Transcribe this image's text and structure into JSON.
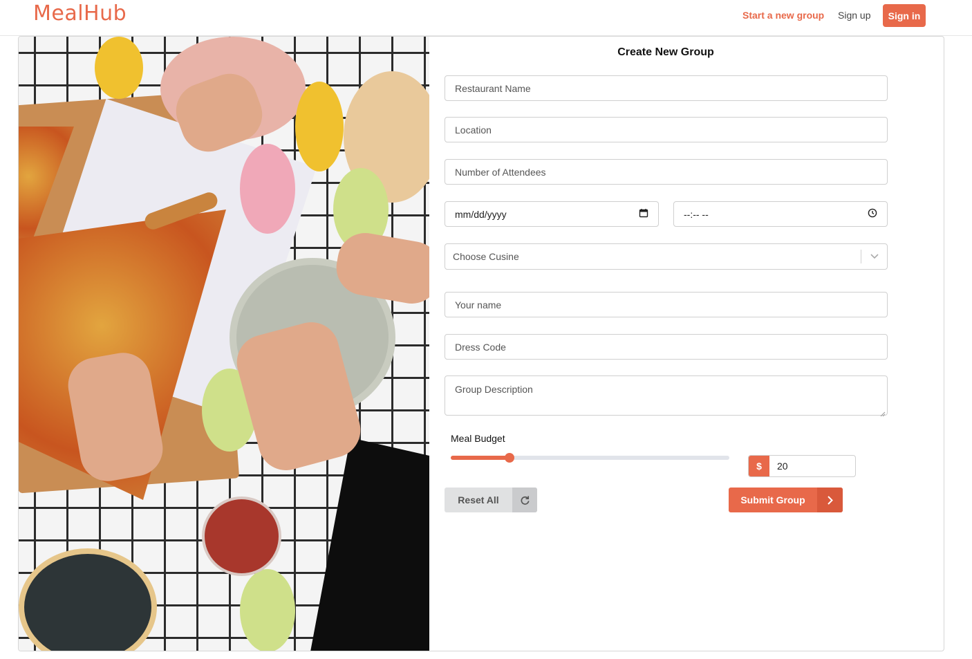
{
  "header": {
    "logo": "MealHub",
    "nav": {
      "start_group": "Start a new group",
      "sign_up": "Sign up",
      "sign_in": "Sign in"
    }
  },
  "form": {
    "title": "Create New Group",
    "fields": {
      "restaurant_name": {
        "placeholder": "Restaurant Name"
      },
      "location": {
        "placeholder": "Location"
      },
      "attendees": {
        "placeholder": "Number of Attendees"
      },
      "date": {
        "placeholder": "mm/dd/yyyy"
      },
      "time": {
        "placeholder": "--:-- --"
      },
      "cuisine": {
        "placeholder": "Choose Cusine"
      },
      "your_name": {
        "placeholder": "Your name"
      },
      "dress_code": {
        "placeholder": "Dress Code"
      },
      "description": {
        "placeholder": "Group Description"
      }
    },
    "budget": {
      "label": "Meal Budget",
      "currency_symbol": "$",
      "value": "20",
      "slider_fraction": 0.21
    },
    "buttons": {
      "reset": "Reset All",
      "submit": "Submit Group"
    }
  },
  "icons": {
    "calendar": "calendar-icon",
    "clock": "clock-icon",
    "chevron_down": "chevron-down-icon",
    "refresh": "refresh-icon",
    "chevron_right": "chevron-right-icon"
  },
  "colors": {
    "accent": "#e8694a",
    "accent_dark": "#d9593b",
    "reset_bg": "#e0e1e2"
  }
}
